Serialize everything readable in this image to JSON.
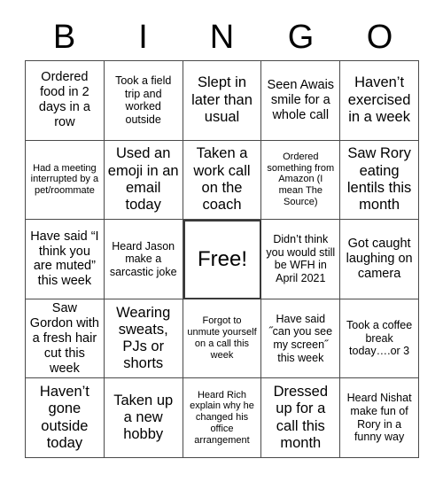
{
  "header": {
    "letters": [
      "B",
      "I",
      "N",
      "G",
      "O"
    ]
  },
  "grid": {
    "rows": 5,
    "columns": 5,
    "cells": [
      {
        "text": "Ordered food in 2 days in a row",
        "size": "fs-md",
        "free": false
      },
      {
        "text": "Took a field trip and worked outside",
        "size": "fs-sm",
        "free": false
      },
      {
        "text": "Slept in later than usual",
        "size": "fs-lg",
        "free": false
      },
      {
        "text": "Seen Awais smile for a whole call",
        "size": "fs-md",
        "free": false
      },
      {
        "text": "Haven’t exercised in a week",
        "size": "fs-lg",
        "free": false
      },
      {
        "text": "Had a meeting interrupted by a pet/roommate",
        "size": "fs-xs",
        "free": false
      },
      {
        "text": "Used an emoji in an email today",
        "size": "fs-lg",
        "free": false
      },
      {
        "text": "Taken a work call on the coach",
        "size": "fs-lg",
        "free": false
      },
      {
        "text": "Ordered something from Amazon (I mean The Source)",
        "size": "fs-xs",
        "free": false
      },
      {
        "text": "Saw Rory eating lentils this month",
        "size": "fs-lg",
        "free": false
      },
      {
        "text": "Have said “I think you are muted” this week",
        "size": "fs-md",
        "free": false
      },
      {
        "text": "Heard Jason make a sarcastic joke",
        "size": "fs-sm",
        "free": false
      },
      {
        "text": "Free!",
        "size": "fs-xl",
        "free": true
      },
      {
        "text": "Didn’t think you would still be WFH in April 2021",
        "size": "fs-sm",
        "free": false
      },
      {
        "text": "Got caught laughing on camera",
        "size": "fs-md",
        "free": false
      },
      {
        "text": "Saw Gordon with a fresh hair cut this week",
        "size": "fs-md",
        "free": false
      },
      {
        "text": "Wearing sweats, PJs or shorts",
        "size": "fs-lg",
        "free": false
      },
      {
        "text": "Forgot to unmute yourself on a call this week",
        "size": "fs-xs",
        "free": false
      },
      {
        "text": "Have said ˝can you see my screen˝ this week",
        "size": "fs-sm",
        "free": false
      },
      {
        "text": "Took a coffee break today….or 3",
        "size": "fs-sm",
        "free": false
      },
      {
        "text": "Haven’t gone outside today",
        "size": "fs-lg",
        "free": false
      },
      {
        "text": "Taken up a new hobby",
        "size": "fs-lg",
        "free": false
      },
      {
        "text": "Heard Rich explain why he changed his office arrangement",
        "size": "fs-xs",
        "free": false
      },
      {
        "text": "Dressed up for a call this month",
        "size": "fs-lg",
        "free": false
      },
      {
        "text": "Heard Nishat make fun of Rory in a funny way",
        "size": "fs-sm",
        "free": false
      }
    ]
  },
  "colors": {
    "background": "#ffffff",
    "text": "#000000",
    "gridline": "#4a4a4a",
    "free_border": "#3a3a3a"
  }
}
